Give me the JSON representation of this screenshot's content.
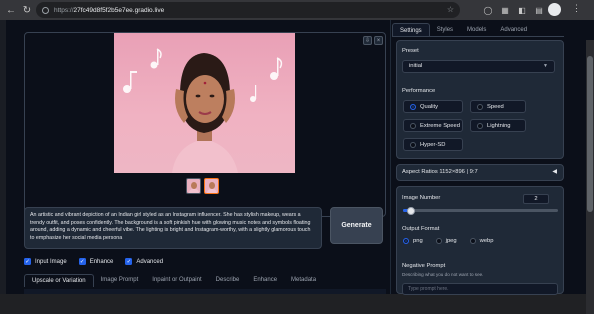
{
  "browser": {
    "url_protocol": "https://",
    "url_host": "27fc49d8f5f2b5e7ee.gradio.live"
  },
  "gallery": {
    "image_alt": "Indian girl Instagram influencer with music notes",
    "thumbnails": 2,
    "active_thumbnail": 2
  },
  "prompt": {
    "text": "An artistic and vibrant depiction of an Indian girl styled as an Instagram influencer. She has stylish makeup, wears a trendy outfit, and poses confidently. The background is a soft pinkish hue with glowing music notes and symbols floating around, adding a dynamic and cheerful vibe. The lighting is bright and Instagram-worthy, with a slightly glamorous touch to emphasize her social media persona"
  },
  "generate_label": "Generate",
  "checkboxes": [
    {
      "label": "Input Image",
      "checked": true
    },
    {
      "label": "Enhance",
      "checked": true
    },
    {
      "label": "Advanced",
      "checked": true
    }
  ],
  "left_tabs": [
    "Upscale or Variation",
    "Image Prompt",
    "Inpaint or Outpaint",
    "Describe",
    "Enhance",
    "Metadata"
  ],
  "right_tabs": [
    "Settings",
    "Styles",
    "Models",
    "Advanced"
  ],
  "settings": {
    "preset_label": "Preset",
    "preset_value": "initial",
    "performance_label": "Performance",
    "performance_options": [
      "Quality",
      "Speed",
      "Extreme Speed",
      "Lightning",
      "Hyper-SD"
    ],
    "performance_selected": "Quality",
    "aspect_ratio_label": "Aspect Ratios 1152×896 | 9:7",
    "image_number_label": "Image Number",
    "image_number_value": "2",
    "image_number_fraction": 0.05,
    "output_format_label": "Output Format",
    "output_format_options": [
      "png",
      "jpeg",
      "webp"
    ],
    "output_format_selected": "png",
    "negative_prompt_label": "Negative Prompt",
    "negative_prompt_desc": "Describing what you do not want to see.",
    "negative_prompt_placeholder": "Type prompt here."
  },
  "colors": {
    "accent": "#2563eb",
    "background": "#0b0f19",
    "panel": "#1f2937"
  }
}
